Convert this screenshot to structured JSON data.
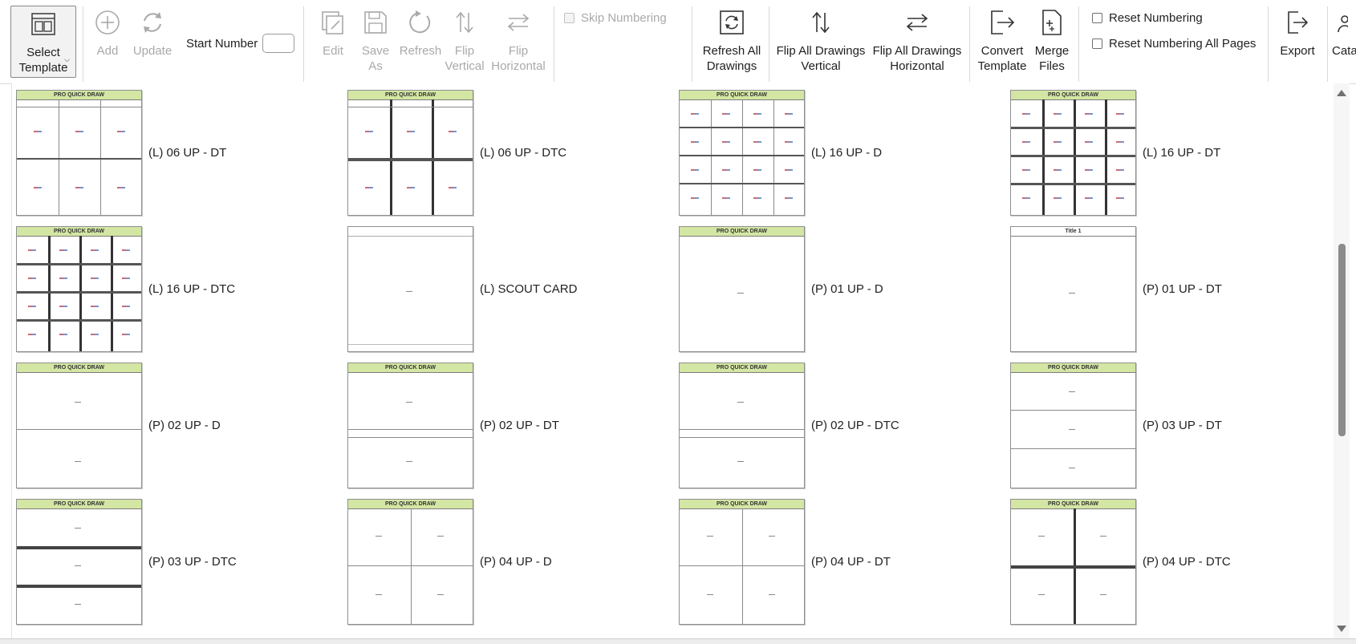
{
  "toolbar": {
    "select_template": "Select\nTemplate",
    "add": "Add",
    "update": "Update",
    "start_number": "Start Number",
    "edit": "Edit",
    "save_as": "Save\nAs",
    "refresh": "Refresh",
    "flip_vertical": "Flip\nVertical",
    "flip_horizontal": "Flip\nHorizontal",
    "skip_numbering": "Skip Numbering",
    "refresh_all": "Refresh All\nDrawings",
    "flip_all_vertical": "Flip All Drawings\nVertical",
    "flip_all_horizontal": "Flip All Drawings\nHorizontal",
    "convert_template": "Convert\nTemplate",
    "merge_files": "Merge\nFiles",
    "reset_numbering": "Reset Numbering",
    "reset_numbering_all": "Reset Numbering All Pages",
    "export": "Export",
    "catalog_partial": "Cata"
  },
  "templates": [
    {
      "label": "(L) 06 UP - DT",
      "header": "PRO QUICK DRAW"
    },
    {
      "label": "(L) 06 UP - DTC",
      "header": "PRO QUICK DRAW"
    },
    {
      "label": "(L) 16 UP - D",
      "header": "PRO QUICK DRAW"
    },
    {
      "label": "(L) 16 UP - DT",
      "header": "PRO QUICK DRAW"
    },
    {
      "label": "(L) 16 UP - DTC",
      "header": "PRO QUICK DRAW"
    },
    {
      "label": "(L) SCOUT CARD",
      "header": ""
    },
    {
      "label": "(P) 01 UP - D",
      "header": "PRO QUICK DRAW"
    },
    {
      "label": "(P) 01 UP - DT",
      "header": "Title 1"
    },
    {
      "label": "(P) 02 UP - D",
      "header": "PRO QUICK DRAW"
    },
    {
      "label": "(P) 02 UP - DT",
      "header": "PRO QUICK DRAW"
    },
    {
      "label": "(P) 02 UP - DTC",
      "header": "PRO QUICK DRAW"
    },
    {
      "label": "(P) 03 UP - DT",
      "header": "PRO QUICK DRAW"
    },
    {
      "label": "(P) 03 UP - DTC",
      "header": "PRO QUICK DRAW"
    },
    {
      "label": "(P) 04 UP - D",
      "header": "PRO QUICK DRAW"
    },
    {
      "label": "(P) 04 UP - DT",
      "header": "PRO QUICK DRAW"
    },
    {
      "label": "(P) 04 UP - DTC",
      "header": "PRO QUICK DRAW"
    }
  ]
}
